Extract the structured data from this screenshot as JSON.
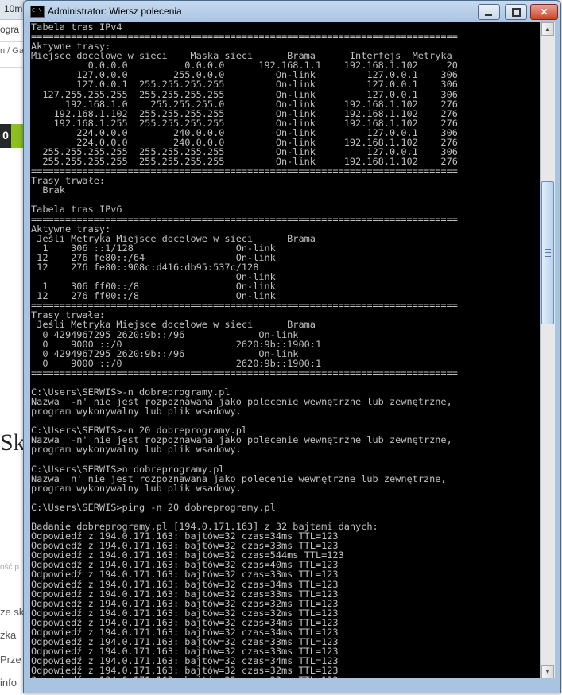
{
  "background": {
    "tab_label": "10mi",
    "addr_text": "ogra",
    "crumb_text": "n / Ga",
    "badge_number": "0",
    "big_text": "Sk",
    "faint_text": "ość p",
    "snippets": [
      "ze sk",
      "zka",
      "Prze",
      "info"
    ]
  },
  "window": {
    "title": "Administrator: Wiersz polecenia",
    "icon": "cmd-icon"
  },
  "console_lines": [
    "Tabela tras IPv4",
    "===========================================================================",
    "Aktywne trasy:",
    "Miejsce docelowe w sieci    Maska sieci      Brama      Interfejs  Metryka",
    "          0.0.0.0          0.0.0.0      192.168.1.1    192.168.1.102     20",
    "        127.0.0.0        255.0.0.0         On-link         127.0.0.1    306",
    "        127.0.0.1  255.255.255.255         On-link         127.0.0.1    306",
    "  127.255.255.255  255.255.255.255         On-link         127.0.0.1    306",
    "      192.168.1.0    255.255.255.0         On-link     192.168.1.102    276",
    "    192.168.1.102  255.255.255.255         On-link     192.168.1.102    276",
    "    192.168.1.255  255.255.255.255         On-link     192.168.1.102    276",
    "        224.0.0.0        240.0.0.0         On-link         127.0.0.1    306",
    "        224.0.0.0        240.0.0.0         On-link     192.168.1.102    276",
    "  255.255.255.255  255.255.255.255         On-link         127.0.0.1    306",
    "  255.255.255.255  255.255.255.255         On-link     192.168.1.102    276",
    "===========================================================================",
    "Trasy trwałe:",
    "  Brak",
    "",
    "Tabela tras IPv6",
    "===========================================================================",
    "Aktywne trasy:",
    " Jeśli Metryka Miejsce docelowe w sieci      Brama",
    "  1    306 ::1/128                  On-link",
    " 12    276 fe80::/64                On-link",
    " 12    276 fe80::908c:d416:db95:537c/128",
    "                                    On-link",
    "  1    306 ff00::/8                 On-link",
    " 12    276 ff00::/8                 On-link",
    "===========================================================================",
    "Trasy trwałe:",
    " Jeśli Metryka Miejsce docelowe w sieci      Brama",
    "  0 4294967295 2620:9b::/96             On-link",
    "  0    9000 ::/0                    2620:9b::1900:1",
    "  0 4294967295 2620:9b::/96             On-link",
    "  0    9000 ::/0                    2620:9b::1900:1",
    "===========================================================================",
    "",
    "C:\\Users\\SERWIS>-n dobreprogramy.pl",
    "Nazwa '-n' nie jest rozpoznawana jako polecenie wewnętrzne lub zewnętrzne,",
    "program wykonywalny lub plik wsadowy.",
    "",
    "C:\\Users\\SERWIS>-n 20 dobreprogramy.pl",
    "Nazwa '-n' nie jest rozpoznawana jako polecenie wewnętrzne lub zewnętrzne,",
    "program wykonywalny lub plik wsadowy.",
    "",
    "C:\\Users\\SERWIS>n dobreprogramy.pl",
    "Nazwa 'n' nie jest rozpoznawana jako polecenie wewnętrzne lub zewnętrzne,",
    "program wykonywalny lub plik wsadowy.",
    "",
    "C:\\Users\\SERWIS>ping -n 20 dobreprogramy.pl",
    "",
    "Badanie dobreprogramy.pl [194.0.171.163] z 32 bajtami danych:",
    "Odpowiedź z 194.0.171.163: bajtów=32 czas=34ms TTL=123",
    "Odpowiedź z 194.0.171.163: bajtów=32 czas=33ms TTL=123",
    "Odpowiedź z 194.0.171.163: bajtów=32 czas=544ms TTL=123",
    "Odpowiedź z 194.0.171.163: bajtów=32 czas=40ms TTL=123",
    "Odpowiedź z 194.0.171.163: bajtów=32 czas=33ms TTL=123",
    "Odpowiedź z 194.0.171.163: bajtów=32 czas=34ms TTL=123",
    "Odpowiedź z 194.0.171.163: bajtów=32 czas=33ms TTL=123",
    "Odpowiedź z 194.0.171.163: bajtów=32 czas=32ms TTL=123",
    "Odpowiedź z 194.0.171.163: bajtów=32 czas=32ms TTL=123",
    "Odpowiedź z 194.0.171.163: bajtów=32 czas=34ms TTL=123",
    "Odpowiedź z 194.0.171.163: bajtów=32 czas=34ms TTL=123",
    "Odpowiedź z 194.0.171.163: bajtów=32 czas=33ms TTL=123",
    "Odpowiedź z 194.0.171.163: bajtów=32 czas=33ms TTL=123",
    "Odpowiedź z 194.0.171.163: bajtów=32 czas=34ms TTL=123",
    "Odpowiedź z 194.0.171.163: bajtów=32 czas=32ms TTL=123",
    "Odpowiedź z 194.0.171.163: bajtów=32 czas=32ms TTL=123",
    "Odpowiedź z 194.0.171.163: bajtów=32 czas=36ms TTL=123",
    "Odpowiedź z 194.0.171.163: bajtów=32 czas=34ms TTL=123"
  ],
  "colors": {
    "console_bg": "#000000",
    "console_fg": "#c0c0c0",
    "title_bar": "#b8d0ea",
    "close_button": "#c9462c"
  }
}
